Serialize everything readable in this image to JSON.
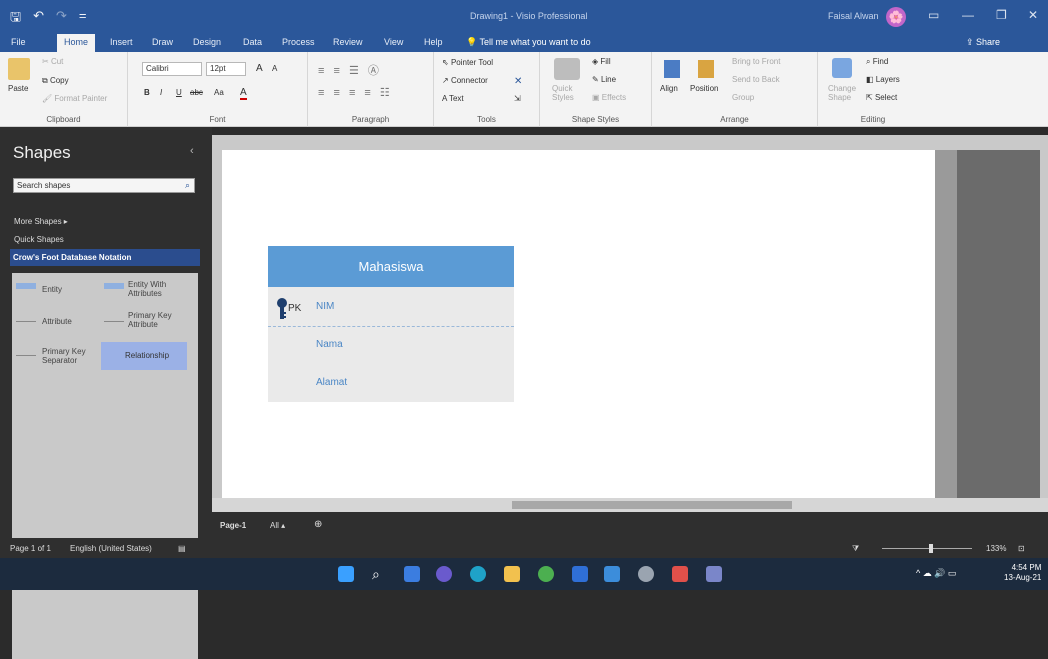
{
  "titlebar": {
    "title": "Drawing1 - Visio Professional",
    "user": "Faisal Alwan",
    "save": "🖫",
    "undo": "↶",
    "redo": "↷",
    "customize": "=",
    "avatar": "🌸",
    "box": "▭",
    "min": "—",
    "restore": "❐",
    "close": "✕"
  },
  "menu": {
    "tabs": [
      "File",
      "Home",
      "Insert",
      "Draw",
      "Design",
      "Data",
      "Process",
      "Review",
      "View",
      "Help"
    ],
    "active": "Home",
    "tell_me": "Tell me what you want to do",
    "share": "Share"
  },
  "ribbon": {
    "clipboard": {
      "paste": "Paste",
      "cut": "Cut",
      "copy": "Copy",
      "format_painter": "Format Painter",
      "label": "Clipboard"
    },
    "font": {
      "family": "Calibri",
      "size": "12pt",
      "grow": "A",
      "shrink": "A",
      "bold": "B",
      "italic": "I",
      "underline": "U",
      "strike": "abc",
      "case": "Aa",
      "color": "A",
      "label": "Font"
    },
    "paragraph": {
      "label": "Paragraph"
    },
    "tools": {
      "pointer": "Pointer Tool",
      "connector": "Connector",
      "text": "Text",
      "label": "Tools"
    },
    "shape_styles": {
      "quick_styles": "Quick Styles",
      "fill": "Fill",
      "line": "Line",
      "effects": "Effects",
      "label": "Shape Styles"
    },
    "arrange": {
      "align": "Align",
      "position": "Position",
      "bring_front": "Bring to Front",
      "send_back": "Send to Back",
      "group": "Group",
      "label": "Arrange"
    },
    "editing": {
      "change_shape": "Change Shape",
      "find": "Find",
      "layers": "Layers",
      "select": "Select",
      "label": "Editing"
    }
  },
  "shapes_panel": {
    "title": "Shapes",
    "collapse": "‹",
    "search_placeholder": "Search shapes",
    "search_icon": "⌕",
    "more_shapes": "More Shapes ▸",
    "quick_shapes": "Quick Shapes",
    "active_stencil": "Crow's Foot Database Notation",
    "stencils": {
      "entity": "Entity",
      "entity_with_attributes": "Entity With Attributes",
      "attribute": "Attribute",
      "primary_key_attribute": "Primary Key Attribute",
      "primary_key_separator": "Primary Key Separator",
      "relationship": "Relationship"
    }
  },
  "diagram": {
    "entity_name": "Mahasiswa",
    "pk_label": "PK",
    "attributes": [
      "NIM",
      "Nama",
      "Alamat"
    ],
    "header_color": "#5b9bd5"
  },
  "page_tabs": {
    "page1": "Page-1",
    "all": "All ▴",
    "add": "⊕"
  },
  "status": {
    "page": "Page 1 of 1",
    "language": "English (United States)",
    "zoom": "133%"
  },
  "taskbar": {
    "time": "4:54 PM",
    "date": "13-Aug-21",
    "tray": "^ ☁ 🔊 ▭"
  }
}
